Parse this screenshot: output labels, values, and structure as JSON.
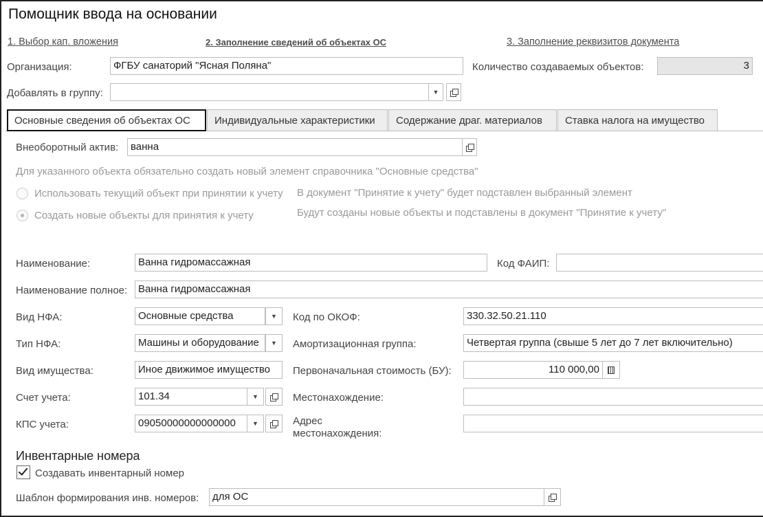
{
  "window": {
    "title": "Помощник ввода на основании"
  },
  "steps": [
    {
      "label": "1. Выбор кап. вложения"
    },
    {
      "label": "2. Заполнение сведений об объектах ОС"
    },
    {
      "label": "3. Заполнение реквизитов документа"
    }
  ],
  "header": {
    "org_label": "Организация:",
    "org_value": "ФГБУ санаторий \"Ясная Поляна\"",
    "count_label": "Количество создаваемых объектов:",
    "count_value": "3",
    "group_label": "Добавлять в группу:",
    "group_value": ""
  },
  "tabs": [
    {
      "label": "Основные сведения об объектах ОС"
    },
    {
      "label": "Индивидуальные характеристики"
    },
    {
      "label": "Содержание драг. материалов"
    },
    {
      "label": "Ставка налога на имущество"
    }
  ],
  "main": {
    "asset_label": "Внеоборотный актив:",
    "asset_value": "ванна",
    "hint": "Для указанного объекта обязательно создать новый элемент справочника \"Основные средства\"",
    "radio_current": "Использовать текущий объект при принятии к учету",
    "radio_current_desc": "В документ \"Принятие к учету\" будет подставлен выбранный элемент",
    "radio_new": "Создать новые объекты для принятия к учету",
    "radio_new_desc": "Будут созданы новые объекты и подставлены в документ \"Принятие к учету\"",
    "name_label": "Наименование:",
    "name_value": "Ванна гидромассажная",
    "faip_label": "Код ФАИП:",
    "faip_value": "",
    "fullname_label": "Наименование полное:",
    "fullname_value": "Ванна гидромассажная",
    "nfa_kind_label": "Вид НФА:",
    "nfa_kind_value": "Основные средства",
    "okof_label": "Код по ОКОФ:",
    "okof_value": "330.32.50.21.110",
    "nfa_type_label": "Тип НФА:",
    "nfa_type_value": "Машины и оборудование",
    "amort_label": "Амортизационная группа:",
    "amort_value": "Четвертая группа (свыше 5 лет до 7 лет включительно)",
    "property_label": "Вид имущества:",
    "property_value": "Иное движимое имущество",
    "cost_label": "Первоначальная стоимость (БУ):",
    "cost_value": "110 000,00",
    "account_label": "Счет учета:",
    "account_value": "101.34",
    "location_label": "Местонахождение:",
    "location_value": "",
    "kps_label": "КПС учета:",
    "kps_value": "09050000000000000",
    "address_label_1": "Адрес",
    "address_label_2": "местонахождения:",
    "address_value": ""
  },
  "inventory": {
    "section_title": "Инвентарные номера",
    "create_label": "Создавать инвентарный номер",
    "create_checked": true,
    "template_label": "Шаблон формирования инв. номеров:",
    "template_value": "для ОС"
  }
}
